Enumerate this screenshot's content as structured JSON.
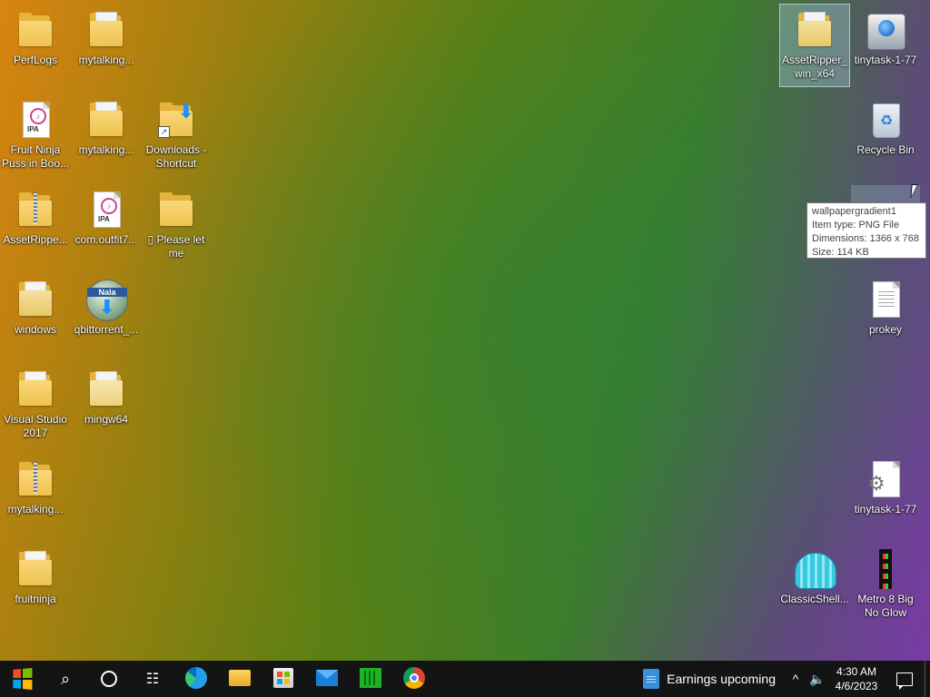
{
  "desktop": {
    "icons": [
      {
        "id": "perflogs",
        "label": "PerfLogs"
      },
      {
        "id": "mytalking1",
        "label": "mytalking..."
      },
      {
        "id": "fruit-ninja",
        "label": "Fruit Ninja\nPuss in Boo..."
      },
      {
        "id": "mytalking2",
        "label": "mytalking..."
      },
      {
        "id": "downloads-shortcut",
        "label": "Downloads -\nShortcut"
      },
      {
        "id": "assetripper-zip",
        "label": "AssetRippe..."
      },
      {
        "id": "com-outfit7",
        "label": "com.outfit7..."
      },
      {
        "id": "please-let-me",
        "label": "▯ Please let me"
      },
      {
        "id": "windows",
        "label": "windows"
      },
      {
        "id": "qbittorrent",
        "label": "qbittorrent_..."
      },
      {
        "id": "visual-studio",
        "label": "Visual Studio\n2017"
      },
      {
        "id": "mingw64",
        "label": "mingw64"
      },
      {
        "id": "mytalking3",
        "label": "mytalking..."
      },
      {
        "id": "fruitninja",
        "label": "fruitninja"
      },
      {
        "id": "assetripper-folder",
        "label": "AssetRipper_\nwin_x64"
      },
      {
        "id": "tinytask-exe",
        "label": "tinytask-1-77"
      },
      {
        "id": "recycle-bin",
        "label": "Recycle Bin"
      },
      {
        "id": "prokey",
        "label": "prokey"
      },
      {
        "id": "tinytask-cfg",
        "label": "tinytask-1-77"
      },
      {
        "id": "classicshell",
        "label": "ClassicShell..."
      },
      {
        "id": "metro8",
        "label": "Metro 8 Big\nNo Glow"
      }
    ],
    "badges": {
      "ipa": "IPA",
      "nala": "Nala"
    }
  },
  "tooltip": {
    "name": "wallpapergradient1",
    "type": "Item type: PNG File",
    "dimensions": "Dimensions: 1366 x 768",
    "size": "Size: 114 KB"
  },
  "taskbar": {
    "news_text": "Earnings upcoming",
    "time": "4:30 AM",
    "date": "4/6/2023",
    "tray_chevron": "^",
    "volume": "🔈"
  },
  "colors": {
    "taskbar": "#141414",
    "folder": "#efc24f",
    "start_logo": [
      "#f25022",
      "#7fba00",
      "#00a4ef",
      "#ffb900"
    ]
  }
}
